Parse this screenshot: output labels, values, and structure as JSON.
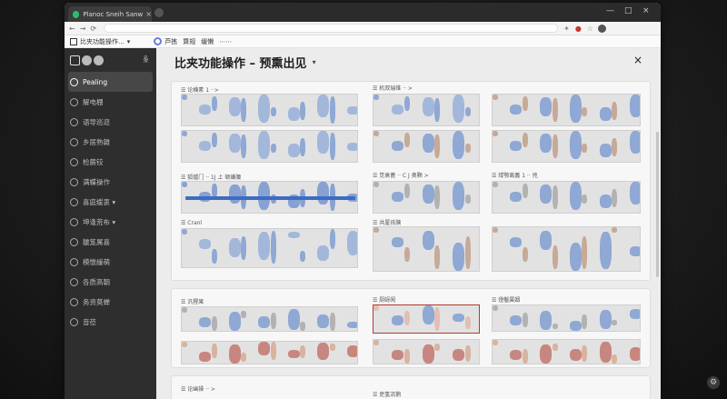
{
  "tab": {
    "title": "Planoc Sneih Sanw...",
    "close_label": "×"
  },
  "window_controls": {
    "minimize": "—",
    "maximize": "□",
    "close": "×"
  },
  "address": {
    "back": "←",
    "forward": "→",
    "reload": "⟳"
  },
  "bookmarks": {
    "project": "比夹功能操作...",
    "items": [
      "芦拣",
      "算规",
      "缓懒",
      "⋯⋯"
    ]
  },
  "sidebar": {
    "items": [
      {
        "label": "Pealing",
        "active": true
      },
      {
        "label": "解电棚"
      },
      {
        "label": "语导巡迩"
      },
      {
        "label": "乡居熟雜"
      },
      {
        "label": "检蕨铰"
      },
      {
        "label": "满蝶操作"
      },
      {
        "label": "喜庭缓衷 ▾"
      },
      {
        "label": "坤逢荒布 ▾"
      },
      {
        "label": "皺笈属喜"
      },
      {
        "label": "模懷緩萌"
      },
      {
        "label": "各质高朝"
      },
      {
        "label": "务资莫蝉"
      },
      {
        "label": "音莅"
      }
    ]
  },
  "main": {
    "title": "比夹功能操作 – 预熏出见",
    "caret": "▾",
    "close": "×",
    "labels": {
      "a1": "☰ 论横素 1 ··>",
      "a2": "☰ 机双瑞维 ·· >",
      "a3": "☰ 狐爐门 ·· 1J 上 顿嫌腰",
      "a4": "☰ 笕衰蓖 ·· C J 奥颗 >",
      "a5": "☰ 缕颚离義 1 ·· 兇",
      "a6": "☰ Cranl",
      "a7": "☰ 共厦孩胰",
      "b1": "☰ 汎猩果",
      "b2": "☰ 厨蚜阂",
      "b3": "☰ 燈鑿属姻",
      "c1": "☰ 论幽操 ·· >",
      "c2": "☰ 吏氢流鹅"
    }
  },
  "colors": {
    "accent": "#3d6bc4",
    "sidebar": "#2e2e2e",
    "tab_icon": "#2dbb6a"
  }
}
